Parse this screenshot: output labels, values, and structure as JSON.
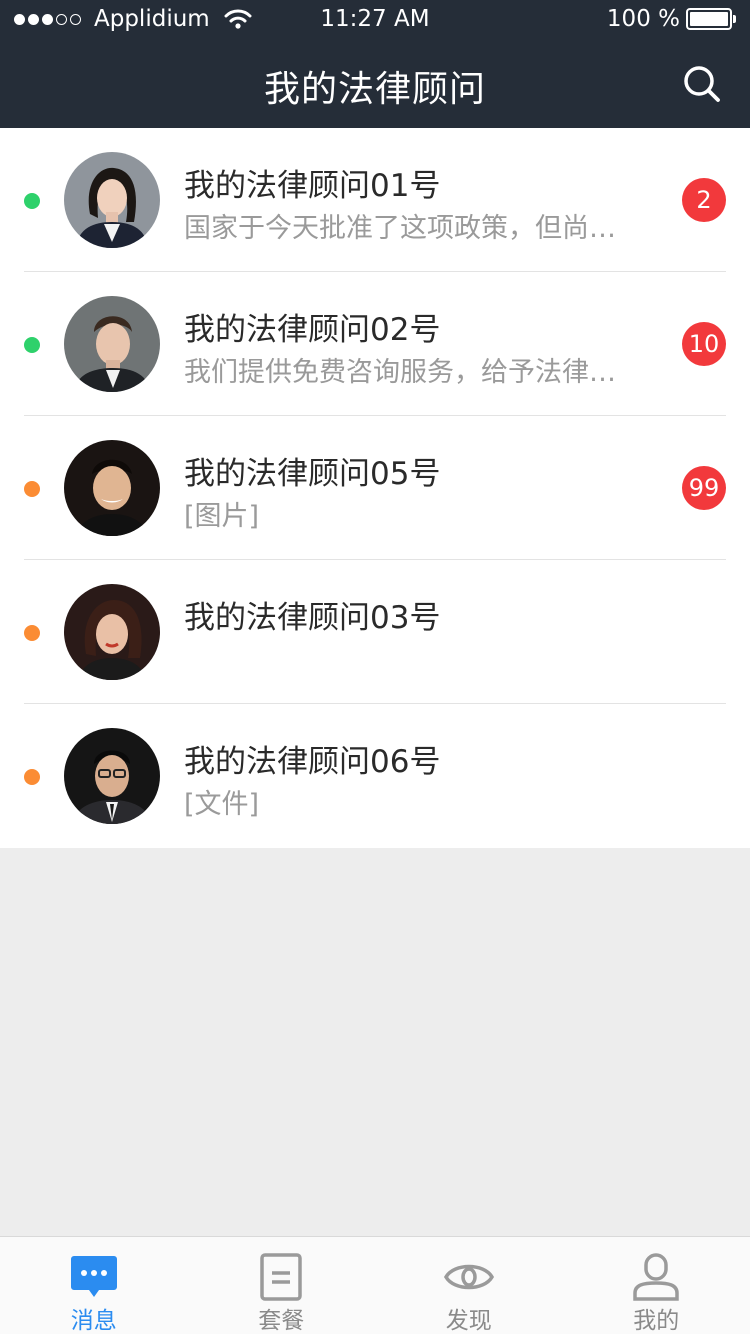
{
  "status_bar": {
    "carrier": "Applidium",
    "time": "11:27 AM",
    "battery": "100 %",
    "signal_icon": "signal-dots-icon",
    "wifi_icon": "wifi-icon",
    "battery_icon": "battery-icon"
  },
  "header": {
    "title": "我的法律顾问",
    "search_icon": "search-icon"
  },
  "conversations": [
    {
      "name": "我的法律顾问01号",
      "preview": "国家于今天批准了这项政策，但尚未公布具体细则",
      "badge": "2",
      "status_color": "#2ed16b"
    },
    {
      "name": "我的法律顾问02号",
      "preview": "我们提供免费咨询服务，给予法律建议和帮助",
      "badge": "10",
      "status_color": "#2ed16b"
    },
    {
      "name": "我的法律顾问05号",
      "preview": "[图片]",
      "badge": "99",
      "status_color": "#fb8c34"
    },
    {
      "name": "我的法律顾问03号",
      "preview": "",
      "badge": "",
      "status_color": "#fb8c34"
    },
    {
      "name": "我的法律顾问06号",
      "preview": "[文件]",
      "badge": "",
      "status_color": "#fb8c34"
    }
  ],
  "tabbar": {
    "items": [
      {
        "label": "消息",
        "icon": "message-icon",
        "active": true
      },
      {
        "label": "套餐",
        "icon": "document-icon",
        "active": false
      },
      {
        "label": "发现",
        "icon": "eye-icon",
        "active": false
      },
      {
        "label": "我的",
        "icon": "person-icon",
        "active": false
      }
    ]
  },
  "colors": {
    "header_bg": "#252d38",
    "accent": "#2b8cf0",
    "badge": "#f2393c",
    "online": "#2ed16b",
    "away": "#fb8c34"
  }
}
